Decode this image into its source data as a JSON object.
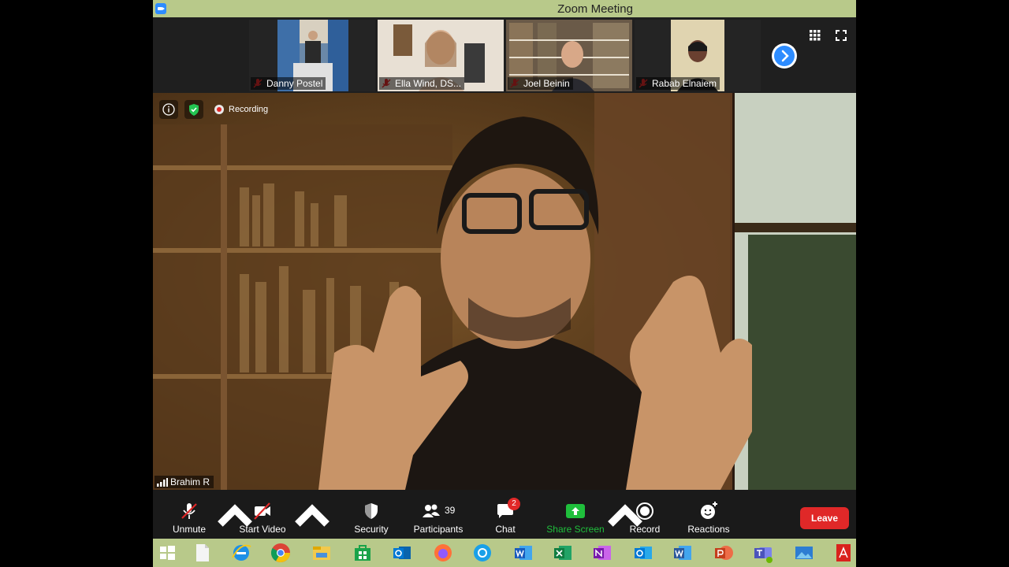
{
  "window": {
    "title": "Zoom Meeting"
  },
  "participants": [
    {
      "name": "Danny Postel",
      "muted": true
    },
    {
      "name": "Ella Wind, DS...",
      "muted": true
    },
    {
      "name": "Joel Beinin",
      "muted": true
    },
    {
      "name": "Rabab Elnaiem",
      "muted": true
    }
  ],
  "main": {
    "speaker": "Brahim R",
    "recording_label": "Recording"
  },
  "toolbar": {
    "unmute": "Unmute",
    "start_video": "Start Video",
    "security": "Security",
    "participants": "Participants",
    "participants_count": "39",
    "chat": "Chat",
    "chat_badge": "2",
    "share_screen": "Share Screen",
    "record": "Record",
    "reactions": "Reactions",
    "leave": "Leave"
  },
  "taskbar_apps": [
    "windows-start",
    "file",
    "internet-explorer",
    "chrome",
    "file-explorer",
    "store",
    "outlook",
    "firefox",
    "settings",
    "word",
    "excel",
    "onenote",
    "outlook-alt",
    "word-alt",
    "powerpoint",
    "teams",
    "photos",
    "acrobat"
  ],
  "colors": {
    "accent": "#2d8cff",
    "leave": "#e02828",
    "share": "#1fbf3c",
    "titlebar": "#b8c98a"
  }
}
